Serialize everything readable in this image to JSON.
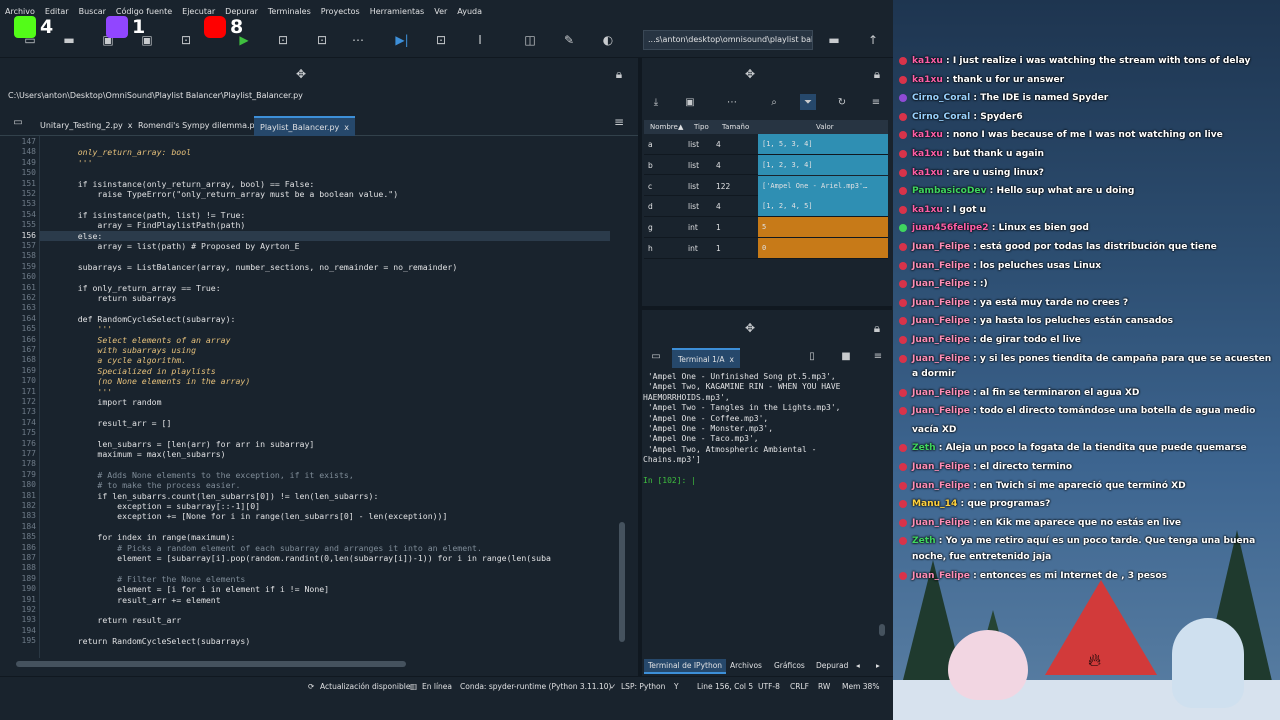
{
  "menu": [
    "Archivo",
    "Editar",
    "Buscar",
    "Código fuente",
    "Ejecutar",
    "Depurar",
    "Terminales",
    "Proyectos",
    "Herramientas",
    "Ver",
    "Ayuda"
  ],
  "badges": {
    "kick_count": "4",
    "twitch_count": "1",
    "youtube_count": "8"
  },
  "toolbar": {
    "path": "...s\\anton\\desktop\\omnisound\\playlist balancer"
  },
  "editor": {
    "path": "C:\\Users\\anton\\Desktop\\OmniSound\\Playlist Balancer\\Playlist_Balancer.py",
    "tabs": [
      "Unitary_Testing_2.py",
      "Romendi's Sympy dilemma.py",
      "Playlist_Balancer.py"
    ],
    "close": "x",
    "line_numbers": [
      "147",
      "148",
      "149",
      "150",
      "151",
      "152",
      "153",
      "154",
      "155",
      "156",
      "157",
      "158",
      "159",
      "160",
      "161",
      "162",
      "163",
      "164",
      "165",
      "166",
      "167",
      "168",
      "169",
      "170",
      "171",
      "172",
      "173",
      "174",
      "175",
      "176",
      "177",
      "178",
      "179",
      "180",
      "181",
      "182",
      "183",
      "184",
      "185",
      "186",
      "187",
      "188",
      "189",
      "190",
      "191",
      "192",
      "193",
      "194",
      "195"
    ],
    "lines": [
      "",
      "    only_return_array: bool",
      "    '''",
      "",
      "    if isinstance(only_return_array, bool) == False:",
      "        raise TypeError(\"only_return_array must be a boolean value.\")",
      "",
      "    if isinstance(path, list) != True:",
      "        array = FindPlaylistPath(path)",
      "    else:",
      "        array = list(path) # Proposed by Ayrton_E",
      "",
      "    subarrays = ListBalancer(array, number_sections, no_remainder = no_remainder)",
      "",
      "    if only_return_array == True:",
      "        return subarrays",
      "",
      "    def RandomCycleSelect(subarray):",
      "        '''",
      "        Select elements of an array",
      "        with subarrays using",
      "        a cycle algorithm.",
      "        Specialized in playlists",
      "        (no None elements in the array)",
      "        '''",
      "        import random",
      "",
      "        result_arr = []",
      "",
      "        len_subarrs = [len(arr) for arr in subarray]",
      "        maximum = max(len_subarrs)",
      "",
      "        # Adds None elements to the exception, if it exists,",
      "        # to make the process easier.",
      "        if len_subarrs.count(len_subarrs[0]) != len(len_subarrs):",
      "            exception = subarray[::-1][0]",
      "            exception += [None for i in range(len_subarrs[0] - len(exception))]",
      "",
      "        for index in range(maximum):",
      "            # Picks a random element of each subarray and arranges it into an element.",
      "            element = [subarray[i].pop(random.randint(0,len(subarray[i])-1)) for i in range(len(suba",
      "",
      "            # Filter the None elements",
      "            element = [i for i in element if i != None]",
      "            result_arr += element",
      "",
      "        return result_arr",
      "",
      "    return RandomCycleSelect(subarrays)"
    ]
  },
  "variables": {
    "headers": [
      "Nombre",
      "Tipo",
      "Tamaño",
      "Valor"
    ],
    "rows": [
      {
        "name": "a",
        "type": "list",
        "size": "4",
        "value": "[1, 5, 3, 4]",
        "color": "#2f8fb3"
      },
      {
        "name": "b",
        "type": "list",
        "size": "4",
        "value": "[1, 2, 3, 4]",
        "color": "#2f8fb3"
      },
      {
        "name": "c",
        "type": "list",
        "size": "122",
        "value": "['Ampel One - Ariel.mp3'…",
        "color": "#2f8fb3"
      },
      {
        "name": "d",
        "type": "list",
        "size": "4",
        "value": "[1, 2, 4, 5]",
        "color": "#2f8fb3"
      },
      {
        "name": "g",
        "type": "int",
        "size": "1",
        "value": "5",
        "color": "#c77a18"
      },
      {
        "name": "h",
        "type": "int",
        "size": "1",
        "value": "0",
        "color": "#c77a18"
      }
    ]
  },
  "terminal": {
    "tab": "Terminal 1/A",
    "lines": [
      " 'Ampel One - Unfinished Song pt.5.mp3',",
      " 'Ampel Two, KAGAMINE RIN - WHEN YOU HAVE",
      "HAEMORRHOIDS.mp3',",
      " 'Ampel Two - Tangles in the Lights.mp3',",
      " 'Ampel One - Coffee.mp3',",
      " 'Ampel One - Monster.mp3',",
      " 'Ampel One - Taco.mp3',",
      " 'Ampel Two, Atmospheric Ambiental -",
      "Chains.mp3']"
    ],
    "prompt": "In [102]: |",
    "bottom_tabs": [
      "Terminal de IPython",
      "Archivos",
      "Gráficos",
      "Depurad"
    ]
  },
  "status": {
    "update": "Actualización disponible",
    "online": "En línea",
    "conda": "Conda: spyder-runtime (Python 3.11.10)",
    "lsp": "LSP: Python",
    "position": "Line 156, Col 5",
    "encoding": "UTF-8",
    "eol": "CRLF",
    "rw": "RW",
    "mem": "Mem 38%"
  },
  "chat": [
    {
      "user": "ka1xu",
      "text": "I just realize i was watching the stream with tons of delay",
      "color": "#ff5fa8",
      "icon": "#d8334a"
    },
    {
      "user": "ka1xu",
      "text": "thank u for ur answer",
      "color": "#ff5fa8",
      "icon": "#d8334a"
    },
    {
      "user": "Cirno_Coral",
      "text": "The IDE is named Spyder",
      "color": "#9ad3ff",
      "icon": "#8f4bd6"
    },
    {
      "user": "Cirno_Coral",
      "text": "Spyder6",
      "color": "#9ad3ff",
      "icon": "#d8334a"
    },
    {
      "user": "ka1xu",
      "text": "nono I was because of me I was not watching on live",
      "color": "#ff5fa8",
      "icon": "#d8334a"
    },
    {
      "user": "ka1xu",
      "text": "but thank u again",
      "color": "#ff5fa8",
      "icon": "#d8334a"
    },
    {
      "user": "ka1xu",
      "text": "are u using linux?",
      "color": "#ff5fa8",
      "icon": "#d8334a"
    },
    {
      "user": "PambasicoDev",
      "text": "Hello sup what are u doing",
      "color": "#3fd65f",
      "icon": "#d8334a"
    },
    {
      "user": "ka1xu",
      "text": "I got u",
      "color": "#ff5fa8",
      "icon": "#d8334a"
    },
    {
      "user": "juan456felipe2",
      "text": "Linux es bien god",
      "color": "#ff5fa8",
      "icon": "#3fd65f"
    },
    {
      "user": "Juan_Felipe",
      "text": "está good por todas las distribución que tiene",
      "color": "#ff8fb8",
      "icon": "#d8334a"
    },
    {
      "user": "Juan_Felipe",
      "text": "los peluches usas Linux",
      "color": "#ff8fb8",
      "icon": "#d8334a"
    },
    {
      "user": "Juan_Felipe",
      "text": ":)",
      "color": "#ff8fb8",
      "icon": "#d8334a"
    },
    {
      "user": "Juan_Felipe",
      "text": "ya está muy tarde no crees ?",
      "color": "#ff8fb8",
      "icon": "#d8334a"
    },
    {
      "user": "Juan_Felipe",
      "text": "ya hasta los peluches están cansados",
      "color": "#ff8fb8",
      "icon": "#d8334a"
    },
    {
      "user": "Juan_Felipe",
      "text": "de girar todo el live",
      "color": "#ff8fb8",
      "icon": "#d8334a"
    },
    {
      "user": "Juan_Felipe",
      "text": "y si les pones tiendita de campaña para que se acuesten a dormir",
      "color": "#ff8fb8",
      "icon": "#d8334a",
      "wrap": true
    },
    {
      "user": "Juan_Felipe",
      "text": "al fin se terminaron el agua XD",
      "color": "#ff8fb8",
      "icon": "#d8334a"
    },
    {
      "user": "Juan_Felipe",
      "text": "todo el directo tomándose una botella de agua medio vacía XD",
      "color": "#ff8fb8",
      "icon": "#d8334a"
    },
    {
      "user": "Zeth",
      "text": "Aleja un poco la fogata de la tiendita que puede quemarse",
      "color": "#3fd65f",
      "icon": "#d8334a"
    },
    {
      "user": "Juan_Felipe",
      "text": "el directo termino",
      "color": "#ff8fb8",
      "icon": "#d8334a"
    },
    {
      "user": "Juan_Felipe",
      "text": "en Twich si me apareció que terminó XD",
      "color": "#ff8fb8",
      "icon": "#d8334a"
    },
    {
      "user": "Manu_14",
      "text": "que programas?",
      "color": "#ffd23f",
      "icon": "#d8334a"
    },
    {
      "user": "Juan_Felipe",
      "text": "en Kik me aparece que no estás en live",
      "color": "#ff8fb8",
      "icon": "#d8334a"
    },
    {
      "user": "Zeth",
      "text": "Yo ya me retiro aquí es un poco tarde. Que tenga una buena noche, fue entretenido jaja",
      "color": "#3fd65f",
      "icon": "#d8334a",
      "wrap": true
    },
    {
      "user": "Juan_Felipe",
      "text": "entonces es mi Internet de , 3 pesos",
      "color": "#ff8fb8",
      "icon": "#d8334a"
    }
  ]
}
